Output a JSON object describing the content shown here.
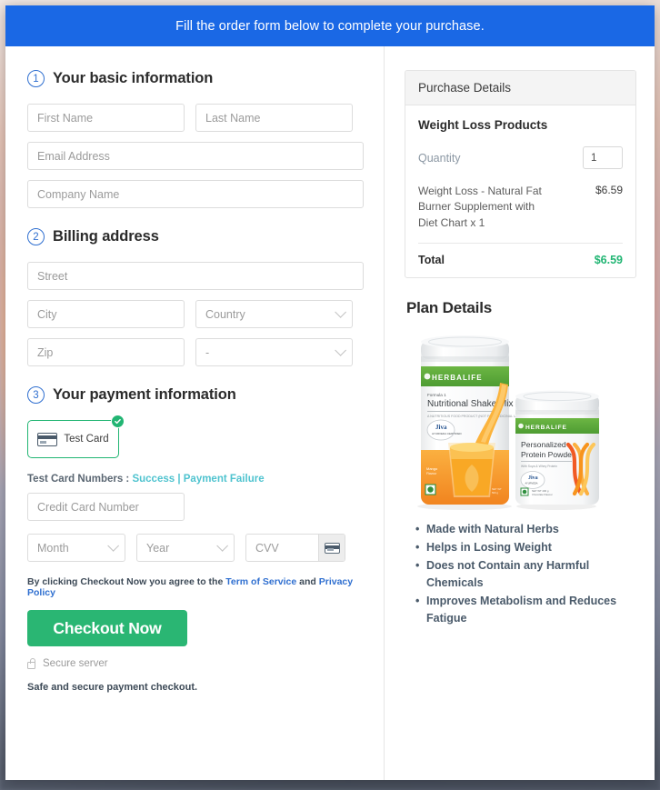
{
  "banner": {
    "message": "Fill the order form below to complete your purchase."
  },
  "form": {
    "step1": {
      "number": "1",
      "title": "Your basic information",
      "first_name_placeholder": "First Name",
      "last_name_placeholder": "Last Name",
      "email_placeholder": "Email Address",
      "company_placeholder": "Company Name"
    },
    "step2": {
      "number": "2",
      "title": "Billing address",
      "street_placeholder": "Street",
      "city_placeholder": "City",
      "country_placeholder": "Country",
      "zip_placeholder": "Zip",
      "state_placeholder": "-"
    },
    "step3": {
      "number": "3",
      "title": "Your payment information",
      "card_tile_label": "Test Card",
      "test_numbers_prefix": "Test Card Numbers : ",
      "test_success_link": "Success",
      "test_separator": " | ",
      "test_failure_link": "Payment Failure",
      "credit_card_placeholder": "Credit Card Number",
      "month_placeholder": "Month",
      "year_placeholder": "Year",
      "cvv_placeholder": "CVV"
    },
    "terms_prefix": "By clicking Checkout Now you agree to the ",
    "terms_link": "Term of Service",
    "terms_middle": " and ",
    "privacy_link": "Privacy Policy",
    "checkout_label": "Checkout Now",
    "secure_server": "Secure server",
    "safe_note": "Safe and secure payment checkout."
  },
  "summary": {
    "header": "Purchase Details",
    "product_group": "Weight Loss Products",
    "quantity_label": "Quantity",
    "quantity_value": "1",
    "line_item_name": "Weight Loss - Natural Fat Burner Supplement with Diet Chart x 1",
    "line_item_price": "$6.59",
    "total_label": "Total",
    "total_value": "$6.59"
  },
  "plan": {
    "title": "Plan Details",
    "product_one_brand": "HERBALIFE",
    "product_one_formula": "Formula 1",
    "product_one_name": "Nutritional Shake Mix",
    "product_one_flavor": "Mango",
    "product_two_brand": "HERBALIFE",
    "product_two_name": "Personalized Protein Powder",
    "benefits": [
      "Made with Natural Herbs",
      "Helps in Losing Weight",
      "Does not Contain any Harmful Chemicals",
      "Improves Metabolism and Reduces Fatigue"
    ]
  },
  "colors": {
    "banner_blue": "#1a68e5",
    "step_blue": "#2f6fd0",
    "success_green": "#2ab673",
    "total_green": "#21b573",
    "link_teal": "#4fc3cf",
    "link_blue": "#2f6fd0"
  }
}
